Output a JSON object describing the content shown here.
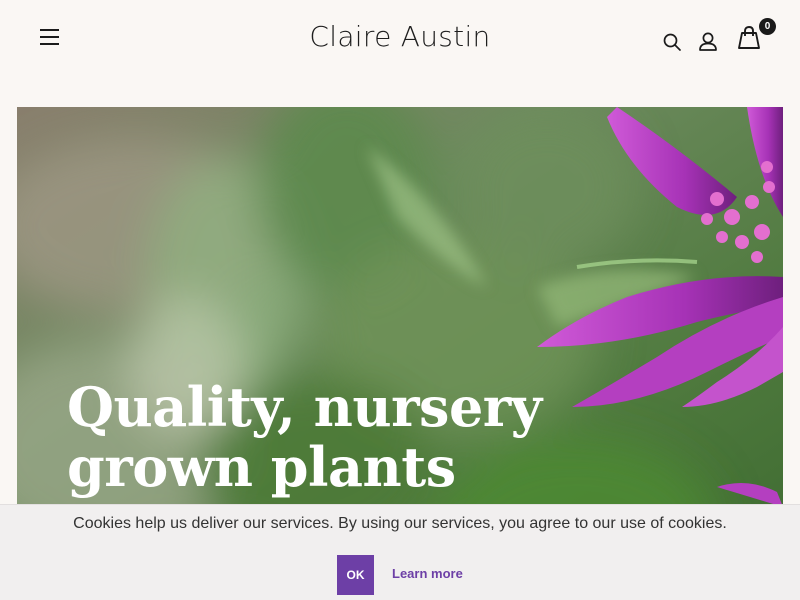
{
  "header": {
    "brand": "Claire Austin",
    "cart_count": "0",
    "icons": [
      "menu-icon",
      "search-icon",
      "user-icon",
      "shopping-bag-icon"
    ]
  },
  "hero": {
    "title_line1": "Quality, nursery",
    "title_line2": "grown plants",
    "image": "purple-flower-photo"
  },
  "cookie": {
    "message": "Cookies help us deliver our services. By using our services, you agree to our use of cookies.",
    "ok_label": "OK",
    "learn_more_label": "Learn more"
  },
  "colors": {
    "background": "#faf7f4",
    "accent": "#6d3fa6",
    "cookie_bar": "#f1efef",
    "flower": "#b43fc0"
  }
}
